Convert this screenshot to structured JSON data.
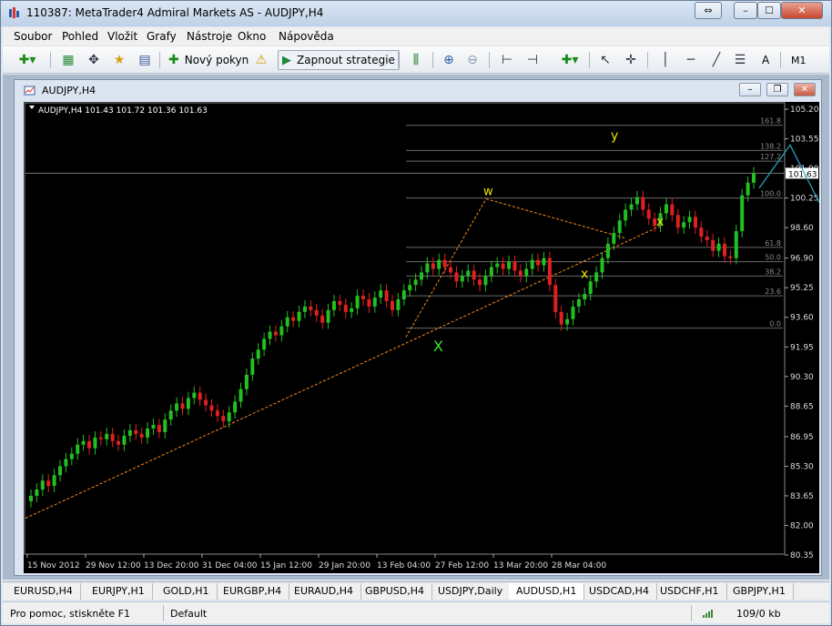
{
  "window": {
    "title": "110387: MetaTrader4 Admiral Markets AS - AUDJPY,H4",
    "buttons": {
      "restore": "⇔",
      "minimize": "–",
      "maximize": "☐",
      "close": "✕"
    }
  },
  "menu": [
    "Soubor",
    "Pohled",
    "Vložit",
    "Grafy",
    "Nástroje",
    "Okno",
    "Nápověda"
  ],
  "toolbar": {
    "new_order": "Nový pokyn",
    "strategies": "Zapnout strategie",
    "timeframe": "M1",
    "text_tool": "A"
  },
  "chart_window": {
    "title": "AUDJPY,H4"
  },
  "chart_data": {
    "type": "candlestick",
    "symbol_line": "AUDJPY,H4  101.43 101.72 101.36 101.63",
    "current_price": "101.63",
    "ylim": [
      80.35,
      105.2
    ],
    "y_ticks": [
      "105.20",
      "103.55",
      "101.90",
      "100.25",
      "98.60",
      "96.90",
      "95.25",
      "93.60",
      "91.95",
      "90.30",
      "88.65",
      "86.95",
      "85.30",
      "83.65",
      "82.00",
      "80.35"
    ],
    "x_ticks": [
      "15 Nov 2012",
      "29 Nov 12:00",
      "13 Dec 20:00",
      "31 Dec 04:00",
      "15 Jan 12:00",
      "29 Jan 20:00",
      "13 Feb 04:00",
      "27 Feb 12:00",
      "13 Mar 20:00",
      "28 Mar 04:00"
    ],
    "fibo_levels": [
      {
        "label": "161.8",
        "price": 104.3
      },
      {
        "label": "138.2",
        "price": 102.9
      },
      {
        "label": "127.2",
        "price": 102.3
      },
      {
        "label": "100.0",
        "price": 100.25
      },
      {
        "label": "61.8",
        "price": 97.5
      },
      {
        "label": "50.0",
        "price": 96.7
      },
      {
        "label": "38.2",
        "price": 95.9
      },
      {
        "label": "23.6",
        "price": 94.8
      },
      {
        "label": "0.0",
        "price": 93.0
      }
    ],
    "annotations": [
      {
        "label": "X",
        "color": "#2ee82e"
      },
      {
        "label": "w",
        "color": "#e5e500"
      },
      {
        "label": "x",
        "color": "#e5e500"
      },
      {
        "label": "x",
        "color": "#e5e500"
      },
      {
        "label": "y",
        "color": "#e5e500"
      }
    ],
    "close_series": [
      83.65,
      84.0,
      84.5,
      84.2,
      84.8,
      85.3,
      85.7,
      86.0,
      86.5,
      86.7,
      86.3,
      86.9,
      86.8,
      87.1,
      86.7,
      86.5,
      87.0,
      87.3,
      87.1,
      86.9,
      87.4,
      87.6,
      87.2,
      87.9,
      88.4,
      88.8,
      88.5,
      89.1,
      89.4,
      89.0,
      88.7,
      88.4,
      88.1,
      87.8,
      88.3,
      88.9,
      89.6,
      90.4,
      91.3,
      91.8,
      92.4,
      92.8,
      92.6,
      93.1,
      93.6,
      93.4,
      93.9,
      94.2,
      94.0,
      93.7,
      93.3,
      94.0,
      94.5,
      94.3,
      93.9,
      94.1,
      94.8,
      94.6,
      94.2,
      94.7,
      95.1,
      94.5,
      94.0,
      94.6,
      95.1,
      95.4,
      95.7,
      96.1,
      96.6,
      96.3,
      96.8,
      96.4,
      96.1,
      95.6,
      95.9,
      96.2,
      95.7,
      95.4,
      95.9,
      96.4,
      96.6,
      96.3,
      96.7,
      96.2,
      95.9,
      96.3,
      96.8,
      96.5,
      96.9,
      95.4,
      93.9,
      93.2,
      93.5,
      94.2,
      94.6,
      94.9,
      95.6,
      96.1,
      96.9,
      97.7,
      98.3,
      99.0,
      99.6,
      99.9,
      100.3,
      99.6,
      99.1,
      98.7,
      99.4,
      99.9,
      99.3,
      98.6,
      98.9,
      99.2,
      98.6,
      98.1,
      97.9,
      97.3,
      97.7,
      97.0,
      96.9,
      98.4,
      100.4,
      101.1,
      101.63
    ],
    "colors": {
      "bull": "#22c022",
      "bear": "#e02020",
      "fib": "#6a6a6a",
      "trend": "#ff8c1a",
      "wave": "#2aa8c4"
    }
  },
  "tabs": [
    "EURUSD,H4",
    "EURJPY,H1",
    "GOLD,H1",
    "EURGBP,H4",
    "EURAUD,H4",
    "GBPUSD,H4",
    "USDJPY,Daily",
    "AUDUSD,H1",
    "USDCAD,H4",
    "USDCHF,H1",
    "GBPJPY,H1"
  ],
  "status": {
    "help": "Pro pomoc, stiskněte F1",
    "profile": "Default",
    "traffic": "109/0 kb"
  }
}
